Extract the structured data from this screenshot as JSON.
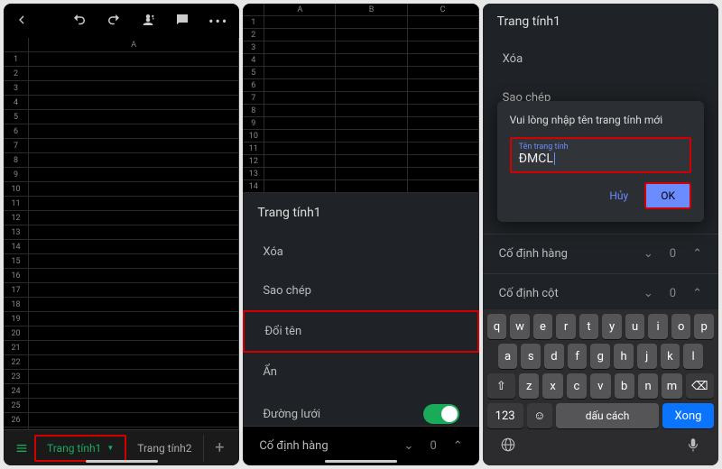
{
  "panel1": {
    "row_count": 27,
    "col_header": "A",
    "tabs": [
      {
        "label": "Trang tính1",
        "active": true,
        "highlighted": true
      },
      {
        "label": "Trang tính2",
        "active": false,
        "highlighted": false
      }
    ]
  },
  "panel2": {
    "col_headers": [
      "A",
      "B",
      "C"
    ],
    "row_count": 14,
    "title": "Trang tính1",
    "menu": [
      {
        "label": "Xóa",
        "highlighted": false,
        "toggle": false
      },
      {
        "label": "Sao chép",
        "highlighted": false,
        "toggle": false
      },
      {
        "label": "Đổi tên",
        "highlighted": true,
        "toggle": false
      },
      {
        "label": "Ẩn",
        "highlighted": false,
        "toggle": false
      },
      {
        "label": "Đường lưới",
        "highlighted": false,
        "toggle": true
      }
    ],
    "freeze": {
      "label": "Cố định hàng",
      "value": "0"
    }
  },
  "panel3": {
    "title": "Trang tính1",
    "menu_visible": [
      {
        "label": "Xóa"
      },
      {
        "label": "Sao chép"
      }
    ],
    "dialog": {
      "title": "Vui lòng nhập tên trang tính mới",
      "input_label": "Tên trang tính",
      "input_value": "ĐMCL",
      "cancel": "Hủy",
      "ok": "OK"
    },
    "freeze_rows": {
      "label": "Cố định hàng",
      "value": "0"
    },
    "freeze_cols": {
      "label": "Cố định cột",
      "value": "0"
    },
    "keyboard": {
      "row1": [
        "q",
        "w",
        "e",
        "r",
        "t",
        "y",
        "u",
        "i",
        "o",
        "p"
      ],
      "row2": [
        "a",
        "s",
        "d",
        "f",
        "g",
        "h",
        "j",
        "k",
        "l"
      ],
      "row3": [
        "z",
        "x",
        "c",
        "v",
        "b",
        "n",
        "m"
      ],
      "shift": "⇧",
      "backspace": "⌫",
      "numbers": "123",
      "emoji": "☺",
      "space": "dấu cách",
      "done": "Xong",
      "globe": "globe",
      "mic": "mic"
    }
  }
}
